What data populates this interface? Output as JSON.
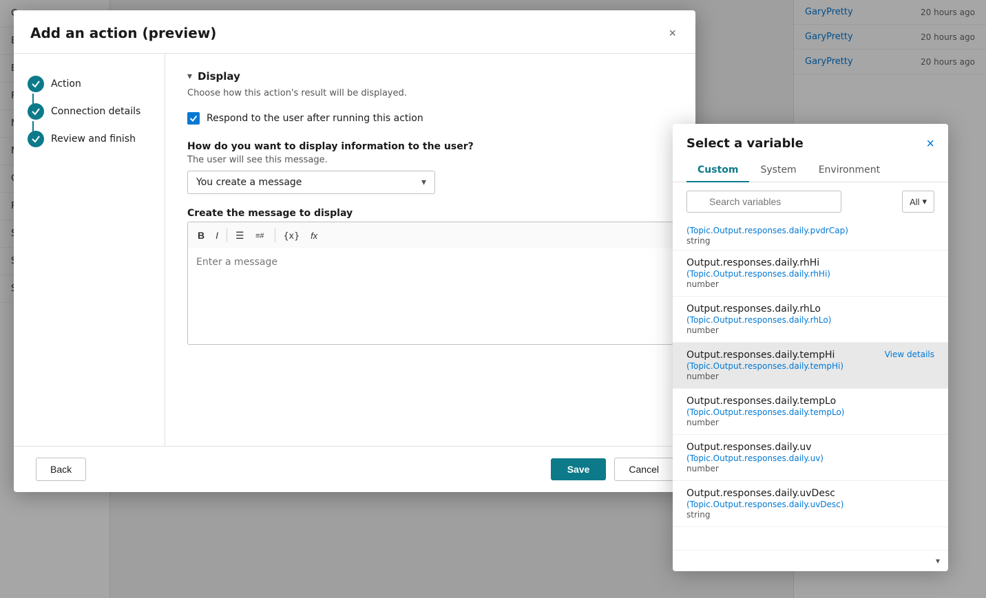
{
  "background": {
    "sidebar_items": [
      "Com...",
      "End...",
      "Esc...",
      "Fall...",
      "MS...",
      "Mu...",
      "On...",
      "Res...",
      "Sig...",
      "Sto...",
      "Sto..."
    ],
    "right_items": [
      {
        "user": "GaryPretty",
        "time": "20 hours ago"
      },
      {
        "user": "GaryPretty",
        "time": "20 hours ago"
      },
      {
        "user": "GaryPretty",
        "time": "20 hours ago"
      }
    ]
  },
  "modal": {
    "title": "Add an action (preview)",
    "close_label": "×",
    "nav_items": [
      {
        "label": "Action"
      },
      {
        "label": "Connection details"
      },
      {
        "label": "Review and finish"
      }
    ],
    "section": {
      "title": "Display",
      "description": "Choose how this action's result will be displayed.",
      "checkbox_label": "Respond to the user after running this action",
      "how_label": "How do you want to display information to the user?",
      "user_will_see": "The user will see this message.",
      "dropdown_value": "You create a message",
      "create_label": "Create the message to display",
      "message_placeholder": "Enter a message"
    },
    "toolbar": {
      "bold": "B",
      "italic": "I",
      "bullet_list": "≡",
      "numbered_list": "≡#",
      "variable": "{x}",
      "formula": "fx"
    },
    "footer": {
      "back_label": "Back",
      "save_label": "Save",
      "cancel_label": "Cancel"
    }
  },
  "variable_panel": {
    "title": "Select a variable",
    "close_label": "×",
    "tabs": [
      {
        "label": "Custom",
        "active": true
      },
      {
        "label": "System",
        "active": false
      },
      {
        "label": "Environment",
        "active": false
      }
    ],
    "search_placeholder": "Search variables",
    "filter_label": "All",
    "first_item": {
      "path": "(Topic.Output.responses.daily.pvdrCap)",
      "type": "string"
    },
    "items": [
      {
        "name": "Output.responses.daily.rhHi",
        "path": "(Topic.Output.responses.daily.rhHi)",
        "type": "number"
      },
      {
        "name": "Output.responses.daily.rhLo",
        "path": "(Topic.Output.responses.daily.rhLo)",
        "type": "number"
      },
      {
        "name": "Output.responses.daily.tempHi",
        "path": "(Topic.Output.responses.daily.tempHi)",
        "type": "number",
        "highlighted": true,
        "view_details": "View details"
      },
      {
        "name": "Output.responses.daily.tempLo",
        "path": "(Topic.Output.responses.daily.tempLo)",
        "type": "number"
      },
      {
        "name": "Output.responses.daily.uv",
        "path": "(Topic.Output.responses.daily.uv)",
        "type": "number"
      },
      {
        "name": "Output.responses.daily.uvDesc",
        "path": "(Topic.Output.responses.daily.uvDesc)",
        "type": "string"
      }
    ]
  }
}
